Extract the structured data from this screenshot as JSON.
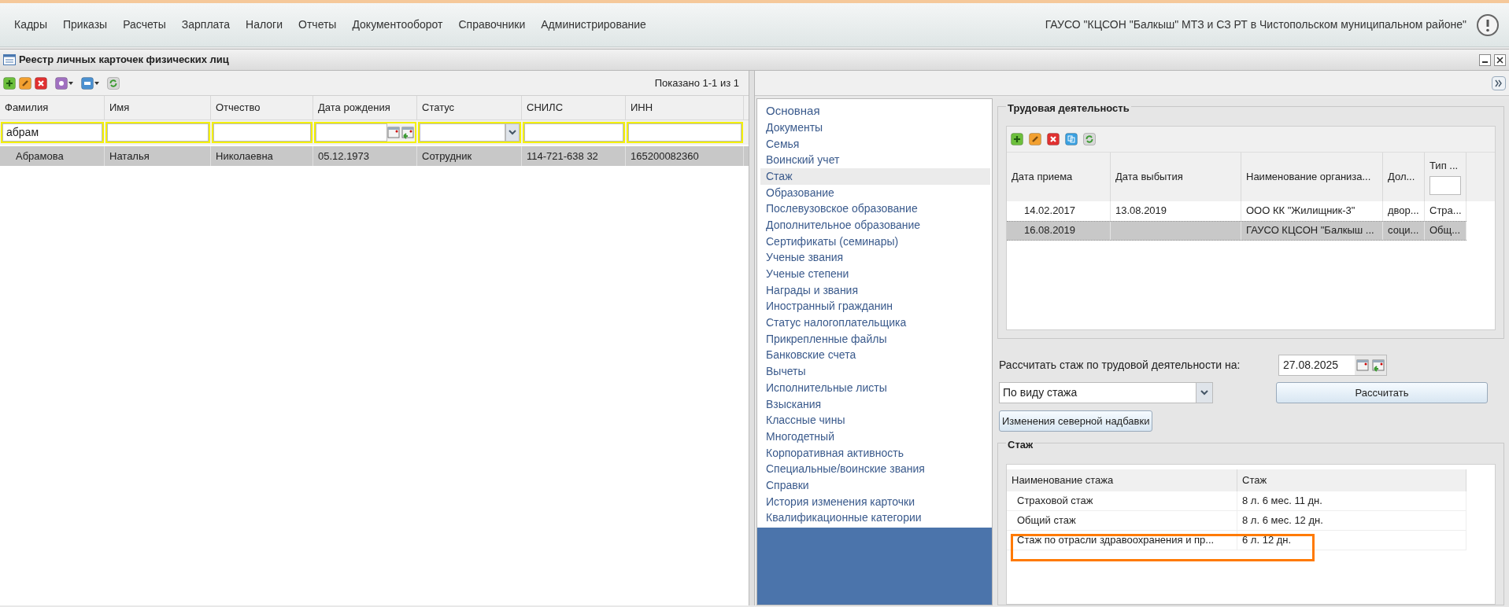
{
  "menu": {
    "items": [
      "Кадры",
      "Приказы",
      "Расчеты",
      "Зарплата",
      "Налоги",
      "Отчеты",
      "Документооборот",
      "Справочники",
      "Администрирование"
    ],
    "organization": "ГАУСО \"КЦСОН \"Балкыш\" МТЗ и СЗ РТ в Чистопольском муниципальном районе\""
  },
  "window": {
    "title": "Реестр личных карточек физических лиц"
  },
  "registry": {
    "shown": "Показано 1-1 из 1",
    "columns": [
      "Фамилия",
      "Имя",
      "Отчество",
      "Дата рождения",
      "Статус",
      "СНИЛС",
      "ИНН"
    ],
    "filters": [
      {
        "kind": "text",
        "value": "абрам"
      },
      {
        "kind": "text"
      },
      {
        "kind": "text"
      },
      {
        "kind": "date"
      },
      {
        "kind": "select"
      },
      {
        "kind": "text"
      },
      {
        "kind": "text"
      }
    ],
    "rows": [
      {
        "selected": true,
        "cells": [
          "Абрамова",
          "Наталья",
          "Николаевна",
          "05.12.1973",
          "Сотрудник",
          "114-721-638 32",
          "165200082360"
        ]
      }
    ]
  },
  "nav": {
    "items": [
      {
        "label": "Основная",
        "kind": "header",
        "selected": false
      },
      {
        "label": "Документы",
        "kind": "link",
        "selected": false
      },
      {
        "label": "Семья",
        "kind": "link",
        "selected": false
      },
      {
        "label": "Воинский учет",
        "kind": "link",
        "selected": false
      },
      {
        "label": "Стаж",
        "kind": "link",
        "selected": true
      },
      {
        "label": "Образование",
        "kind": "link",
        "selected": false
      },
      {
        "label": "Послевузовское образование",
        "kind": "link",
        "selected": false
      },
      {
        "label": "Дополнительное образование",
        "kind": "link",
        "selected": false
      },
      {
        "label": "Сертификаты (семинары)",
        "kind": "link",
        "selected": false
      },
      {
        "label": "Ученые звания",
        "kind": "link",
        "selected": false
      },
      {
        "label": "Ученые степени",
        "kind": "link",
        "selected": false
      },
      {
        "label": "Награды и звания",
        "kind": "link",
        "selected": false
      },
      {
        "label": "Иностранный гражданин",
        "kind": "link",
        "selected": false
      },
      {
        "label": "Статус налогоплательщика",
        "kind": "link",
        "selected": false
      },
      {
        "label": "Прикрепленные файлы",
        "kind": "link",
        "selected": false
      },
      {
        "label": "Банковские счета",
        "kind": "link",
        "selected": false
      },
      {
        "label": "Вычеты",
        "kind": "link",
        "selected": false
      },
      {
        "label": "Исполнительные листы",
        "kind": "link",
        "selected": false
      },
      {
        "label": "Взыскания",
        "kind": "link",
        "selected": false
      },
      {
        "label": "Классные чины",
        "kind": "link",
        "selected": false
      },
      {
        "label": "Многодетный",
        "kind": "link",
        "selected": false
      },
      {
        "label": "Корпоративная активность",
        "kind": "link",
        "selected": false
      },
      {
        "label": "Специальные/воинские звания",
        "kind": "link",
        "selected": false
      },
      {
        "label": "Справки",
        "kind": "link",
        "selected": false
      },
      {
        "label": "История изменения карточки",
        "kind": "link",
        "selected": false
      },
      {
        "label": "Квалификационные категории",
        "kind": "link",
        "selected": false
      }
    ]
  },
  "employment": {
    "title": "Трудовая деятельность",
    "columns": [
      "Дата приема",
      "Дата выбытия",
      "Наименование организа...",
      "Дол...",
      "Тип ..."
    ],
    "rows": [
      {
        "selected": false,
        "cells": [
          "14.02.2017",
          "13.08.2019",
          "ООО КК \"Жилищник-3\"",
          "двор...",
          "Стра..."
        ]
      },
      {
        "selected": true,
        "cells": [
          "16.08.2019",
          "",
          "ГАУСО КЦСОН \"Балкыш ...",
          "соци...",
          "Общ..."
        ]
      }
    ]
  },
  "calc": {
    "label": "Рассчитать стаж по трудовой деятельности на:",
    "date": "27.08.2025",
    "mode": "По виду стажа",
    "calc_button": "Рассчитать",
    "north_button": "Изменения северной надбавки"
  },
  "seniority": {
    "title": "Стаж",
    "columns": [
      "Наименование стажа",
      "Стаж"
    ],
    "rows": [
      {
        "highlighted": false,
        "cells": [
          "Страховой стаж",
          "8 л. 6 мес. 11 дн."
        ]
      },
      {
        "highlighted": false,
        "cells": [
          "Общий стаж",
          "8 л. 6 мес. 12 дн."
        ]
      },
      {
        "highlighted": true,
        "cells": [
          "Стаж по отрасли здравоохранения и пр...",
          "6 л. 12 дн."
        ]
      }
    ]
  }
}
